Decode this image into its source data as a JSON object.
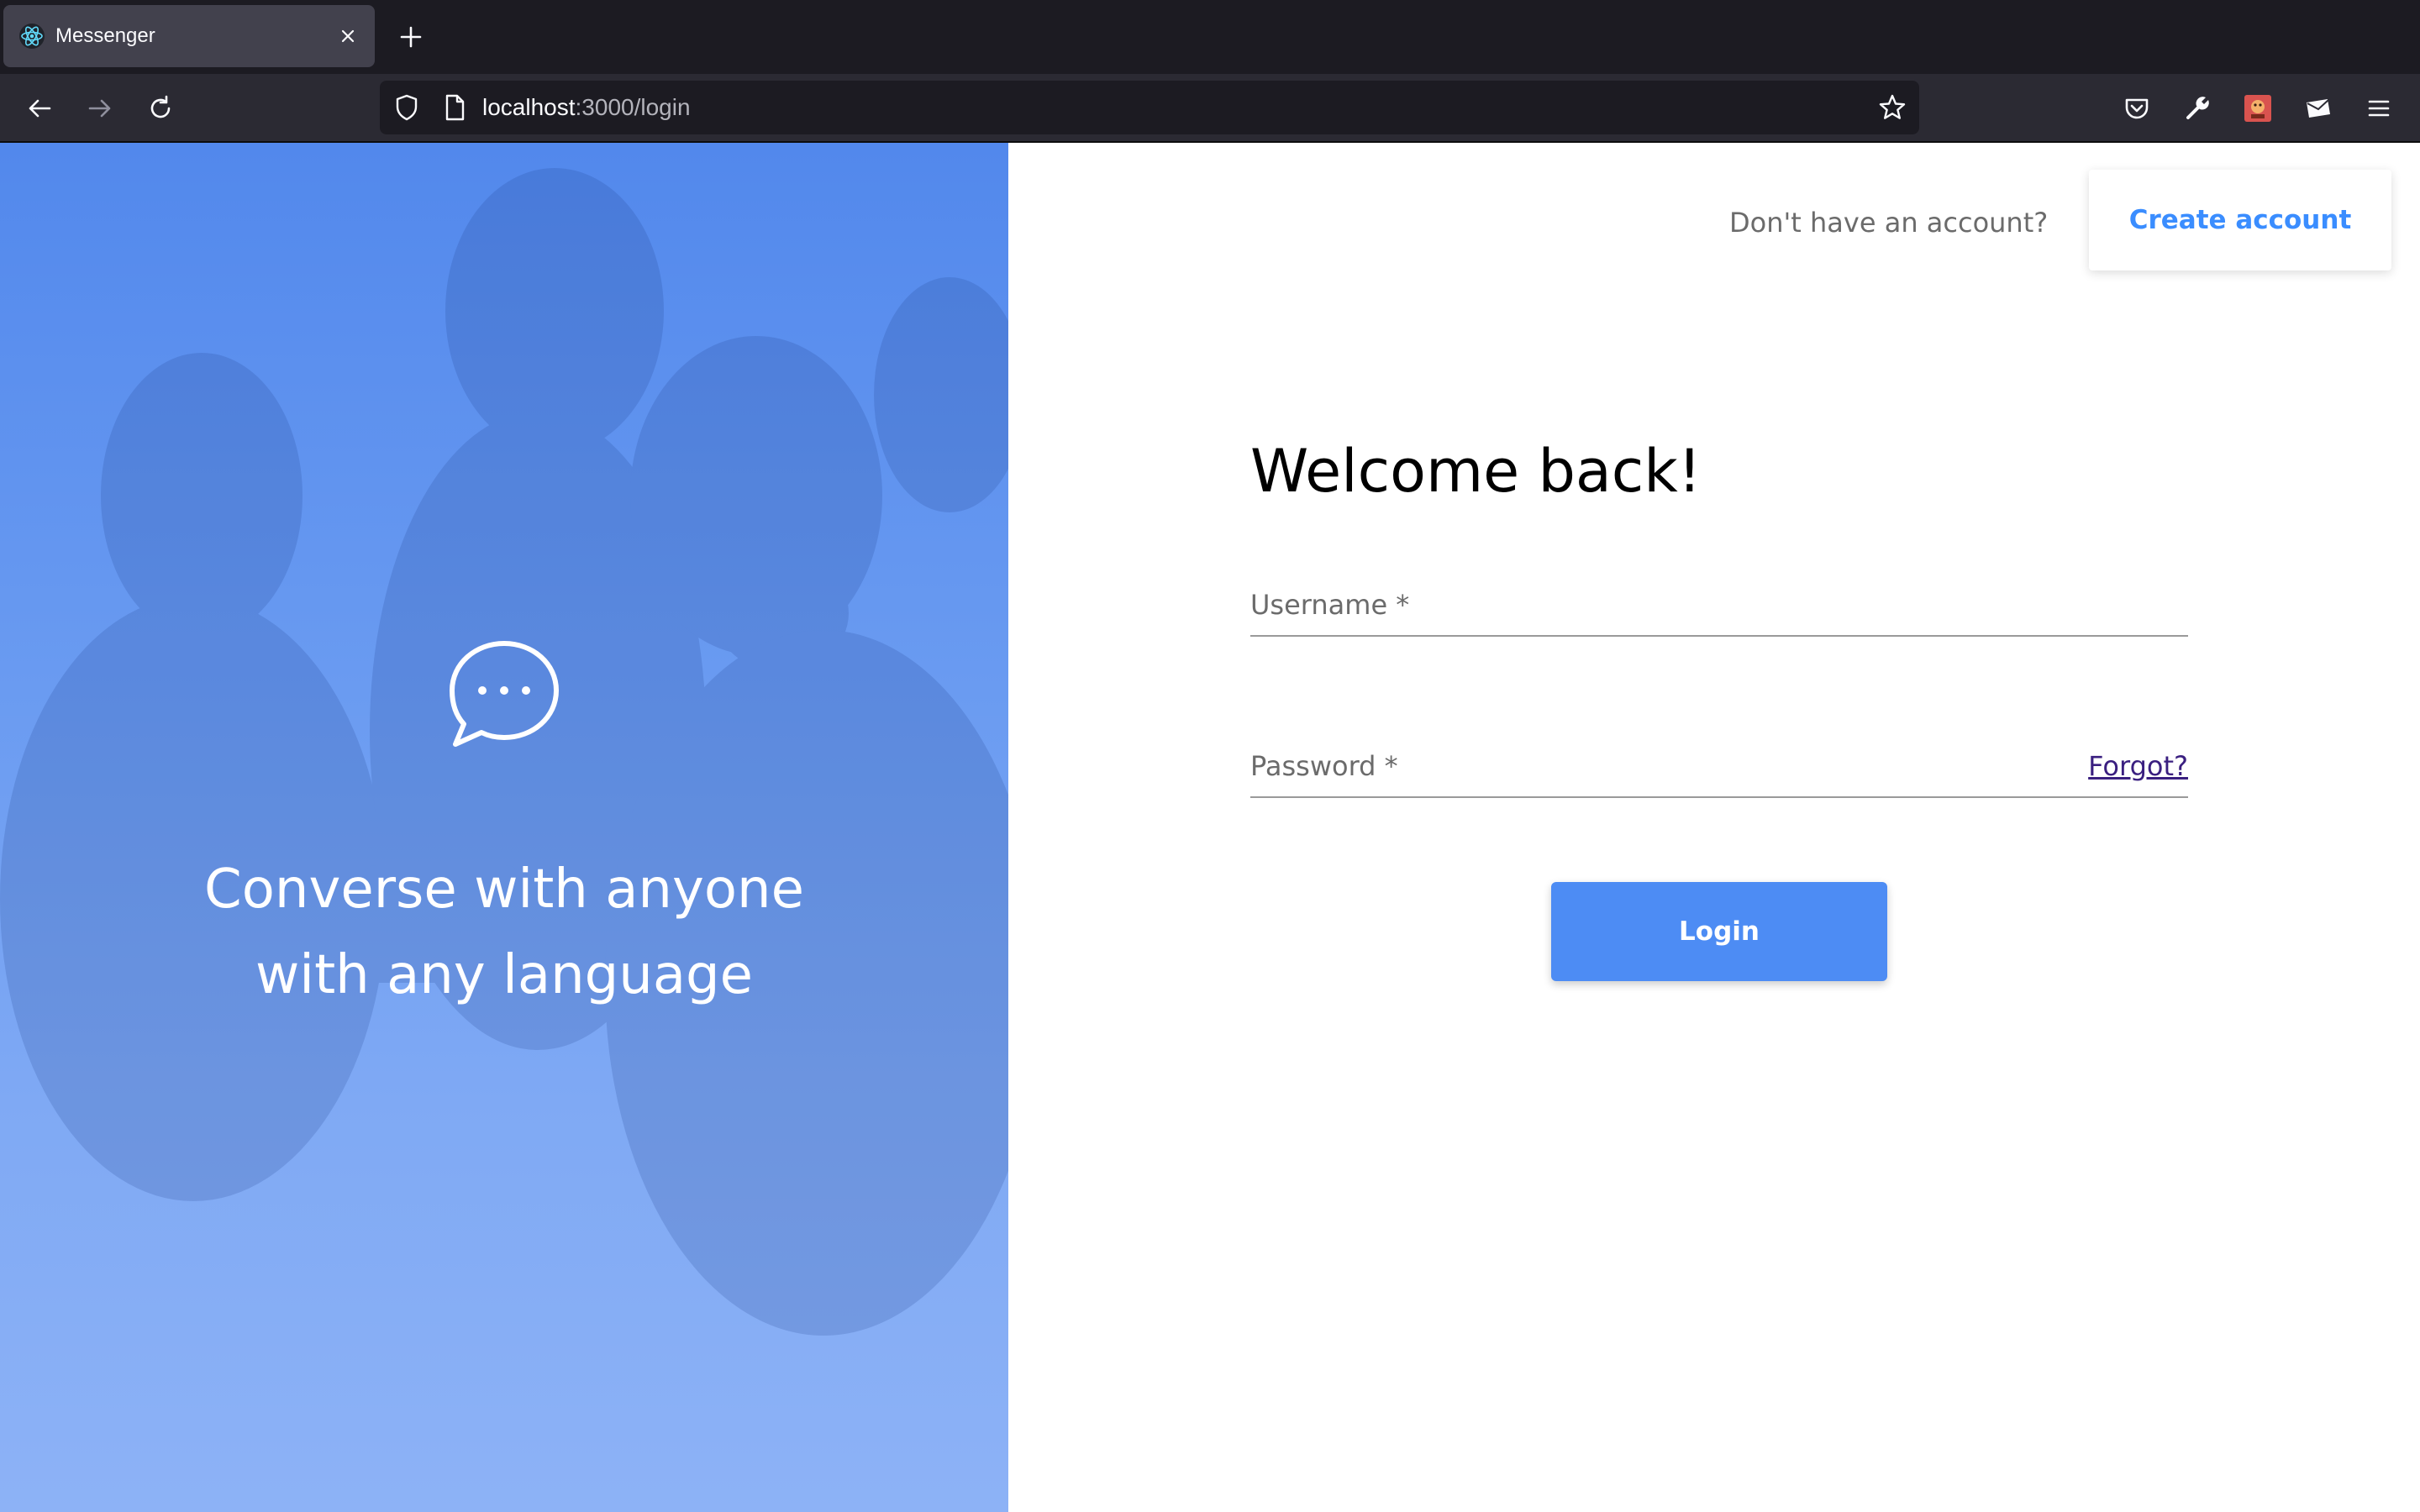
{
  "browser": {
    "tab": {
      "title": "Messenger",
      "favicon": "react-atom-icon"
    },
    "url": {
      "host": "localhost",
      "rest": ":3000/login"
    },
    "icons": [
      "back-icon",
      "forward-icon",
      "reload-icon",
      "shield-icon",
      "page-icon",
      "bookmark-star-icon",
      "pocket-icon",
      "wrench-icon",
      "extension-icon",
      "mail-extension-icon",
      "menu-icon"
    ]
  },
  "hero": {
    "icon": "chat-bubble-icon",
    "tagline_line1": "Converse with anyone",
    "tagline_line2": "with any language",
    "gradient_top": "#5288ec",
    "gradient_bottom": "#8db2f6"
  },
  "auth": {
    "prompt": "Don't have an account?",
    "create_account_label": "Create account",
    "accent": "#3a8dff"
  },
  "form": {
    "heading": "Welcome back!",
    "username_label": "Username *",
    "username_value": "",
    "password_label": "Password *",
    "password_value": "",
    "forgot_label": "Forgot?",
    "login_label": "Login",
    "button_color": "#4d8cf4"
  }
}
